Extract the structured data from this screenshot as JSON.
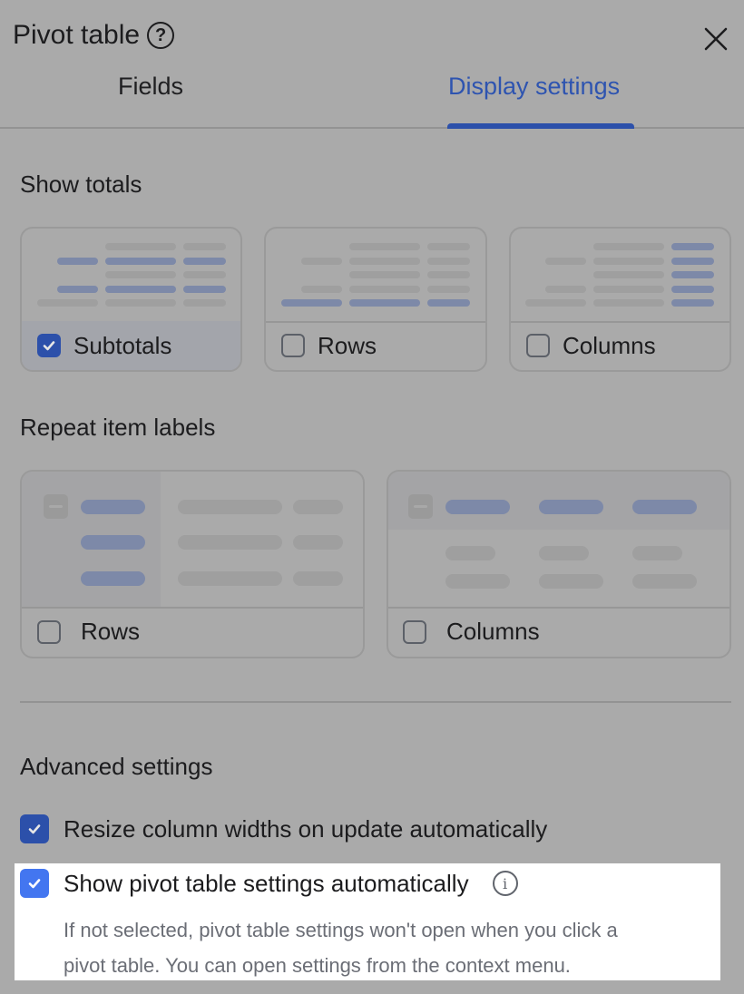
{
  "header": {
    "title": "Pivot table",
    "help_icon": "question-circle-icon",
    "close_icon": "close-x-icon"
  },
  "tabs": [
    {
      "label": "Fields",
      "active": false
    },
    {
      "label": "Display settings",
      "active": true
    }
  ],
  "show_totals": {
    "title": "Show totals",
    "options": [
      {
        "label": "Subtotals",
        "checked": true
      },
      {
        "label": "Rows",
        "checked": false
      },
      {
        "label": "Columns",
        "checked": false
      }
    ]
  },
  "repeat_item_labels": {
    "title": "Repeat item labels",
    "options": [
      {
        "label": "Rows",
        "checked": false
      },
      {
        "label": "Columns",
        "checked": false
      }
    ]
  },
  "advanced_settings": {
    "title": "Advanced settings",
    "options": [
      {
        "label": "Resize column widths on update automatically",
        "checked": true
      },
      {
        "label": "Show pivot table settings automatically",
        "checked": true,
        "info_icon": "info-circle-icon",
        "description_line1": "If not selected, pivot table settings won't open when you click a",
        "description_line2": "pivot table. You can open settings from the context menu."
      }
    ]
  },
  "colors": {
    "accent": "#2c50aa",
    "accent_bright": "#4376f0",
    "overlay": "#aaaaaa",
    "preview_highlight": "#7d89a8"
  }
}
